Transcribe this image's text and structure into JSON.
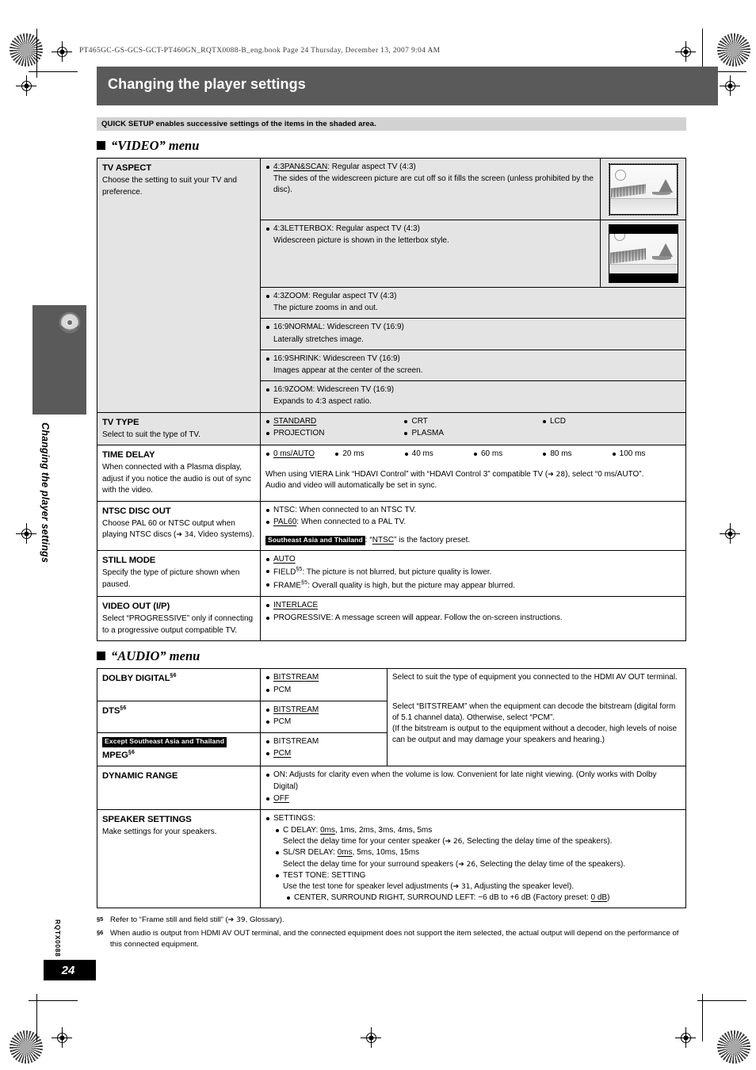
{
  "page": {
    "file_header": "PT465GC-GS-GCS-GCT-PT460GN_RQTX0088-B_eng.book   Page 24   Thursday, December 13, 2007   9:04 AM",
    "title": "Changing the player settings",
    "side_tab_label": "Changing the player settings",
    "side_code": "RQTX0088",
    "page_number": "24",
    "quick_setup_banner": "QUICK SETUP enables successive settings of the items in the shaded area."
  },
  "video_menu": {
    "heading": "“VIDEO” menu",
    "rows": [
      {
        "name": "TV ASPECT",
        "desc": "Choose the setting to suit your TV and preference.",
        "options": [
          {
            "label": "4:3PAN&SCAN",
            "label_underlined": true,
            "head": ":  Regular aspect TV (4:3)",
            "detail": "The sides of the widescreen picture are cut off so it fills the screen (unless prohibited by the disc).",
            "thumb": "pan-scan"
          },
          {
            "label": "4:3LETTERBOX",
            "label_underlined": false,
            "head": ":  Regular aspect TV (4:3)",
            "detail": "Widescreen picture is shown in the letterbox style.",
            "thumb": "letterbox"
          },
          {
            "label": "4:3ZOOM",
            "label_underlined": false,
            "head": ":  Regular aspect TV (4:3)",
            "detail": "The picture zooms in and out.",
            "thumb": ""
          },
          {
            "label": "16:9NORMAL",
            "label_underlined": false,
            "head": ":  Widescreen TV (16:9)",
            "detail": "Laterally stretches image.",
            "thumb": ""
          },
          {
            "label": "16:9SHRINK",
            "label_underlined": false,
            "head": ":  Widescreen TV (16:9)",
            "detail": "Images appear at the center of the screen.",
            "thumb": ""
          },
          {
            "label": "16:9ZOOM",
            "label_underlined": false,
            "head": ":  Widescreen TV (16:9)",
            "detail": "Expands to 4:3 aspect ratio.",
            "thumb": ""
          }
        ]
      }
    ],
    "tv_type": {
      "name": "TV TYPE",
      "desc": "Select to suit the type of TV.",
      "options": [
        "STANDARD",
        "CRT",
        "LCD",
        "PROJECTION",
        "PLASMA"
      ],
      "default": "STANDARD"
    },
    "time_delay": {
      "name": "TIME DELAY",
      "desc": "When connected with a Plasma display, adjust if you notice the audio is out of sync with the video.",
      "options": [
        "0 ms/AUTO",
        "20 ms",
        "40 ms",
        "60 ms",
        "80 ms",
        "100 ms"
      ],
      "default": "0 ms/AUTO",
      "note_a": "When using VIERA Link “HDAVI Control” with “HDAVI Control 3” compatible TV (",
      "note_ref": "➔ 28",
      "note_b": "), select “0 ms/AUTO”.",
      "note_c": "Audio and video will automatically be set in sync."
    },
    "ntsc_disc_out": {
      "name": "NTSC DISC OUT",
      "desc_a": "Choose PAL 60 or NTSC output when playing NTSC discs (",
      "desc_ref": "➔ 34",
      "desc_b": ", Video systems).",
      "opt1_label": "NTSC",
      "opt1_text": ":  When connected to an NTSC TV.",
      "opt2_label": "PAL60",
      "opt2_text": ":  When connected to a PAL TV.",
      "region_badge": "Southeast Asia and Thailand",
      "region_text_a": ": “",
      "region_value": "NTSC",
      "region_text_b": "” is the factory preset."
    },
    "still_mode": {
      "name": "STILL MODE",
      "desc": "Specify the type of picture shown when paused.",
      "opt1": "AUTO",
      "opt2_label": "FIELD",
      "opt2_fn": "§5",
      "opt2_text": ": The picture is not blurred, but picture quality is lower.",
      "opt3_label": "FRAME",
      "opt3_fn": "§5",
      "opt3_text": ": Overall quality is high, but the picture may appear blurred."
    },
    "video_out": {
      "name": "VIDEO OUT (I/P)",
      "desc": "Select “PROGRESSIVE” only if connecting to a progressive output compatible TV.",
      "opt1": "INTERLACE",
      "opt2": "PROGRESSIVE: A message screen will appear. Follow the on-screen instructions."
    }
  },
  "audio_menu": {
    "heading": "“AUDIO” menu",
    "dolby_digital": {
      "name": "DOLBY DIGITAL",
      "fn": "§6",
      "options": [
        "BITSTREAM",
        "PCM"
      ],
      "default": "BITSTREAM"
    },
    "dts": {
      "name": "DTS",
      "fn": "§6",
      "options": [
        "BITSTREAM",
        "PCM"
      ],
      "default": "BITSTREAM"
    },
    "mpeg": {
      "region_badge": "Except Southeast Asia and Thailand",
      "name": "MPEG",
      "fn": "§6",
      "options": [
        "BITSTREAM",
        "PCM"
      ],
      "default": "PCM"
    },
    "shared_desc": {
      "p1": "Select to suit the type of equipment you connected to the HDMI AV OUT terminal.",
      "p2": "Select “BITSTREAM” when the equipment can decode the bitstream (digital form of 5.1 channel data). Otherwise, select “PCM”.",
      "p3": "(If the bitstream is output to the equipment without a decoder, high levels of noise can be output and may damage your speakers and hearing.)"
    },
    "dynamic_range": {
      "name": "DYNAMIC RANGE",
      "on_label": "ON",
      "on_text": ":  Adjusts for clarity even when the volume is low. Convenient for late night viewing. (Only works with Dolby Digital)",
      "off_label": "OFF",
      "default": "OFF"
    },
    "speaker_settings": {
      "name": "SPEAKER SETTINGS",
      "desc": "Make settings for your speakers.",
      "settings_label": "SETTINGS:",
      "c_delay_label": "C DELAY: ",
      "c_delay_default": "0ms",
      "c_delay_rest": ", 1ms, 2ms, 3ms, 4ms, 5ms",
      "c_delay_note_a": "Select the delay time for your center speaker (",
      "c_delay_ref": "➔ 26",
      "c_delay_note_b": ", Selecting the delay time of the speakers).",
      "slsr_label": "SL/SR DELAY: ",
      "slsr_default": "0ms",
      "slsr_rest": ", 5ms, 10ms, 15ms",
      "slsr_note_a": "Select the delay time for your surround speakers (",
      "slsr_ref": "➔ 26",
      "slsr_note_b": ", Selecting the delay time of the speakers).",
      "test_tone": "TEST TONE: SETTING",
      "test_note_a": "Use the test tone for speaker level adjustments (",
      "test_ref": "➔ 31",
      "test_note_b": ", Adjusting the speaker level).",
      "levels_a": "CENTER, SURROUND RIGHT, SURROUND LEFT: −6 dB to +6 dB (Factory preset: ",
      "levels_default": "0 dB",
      "levels_b": ")"
    }
  },
  "footnotes": [
    {
      "mark": "§5",
      "text_a": "Refer to “Frame still and field still” (",
      "ref": "➔ 39",
      "text_b": ", Glossary)."
    },
    {
      "mark": "§6",
      "text_a": "When audio is output from HDMI AV OUT terminal, and the connected equipment does not support the item selected, the actual output will depend on the performance of this connected equipment.",
      "ref": "",
      "text_b": ""
    }
  ]
}
